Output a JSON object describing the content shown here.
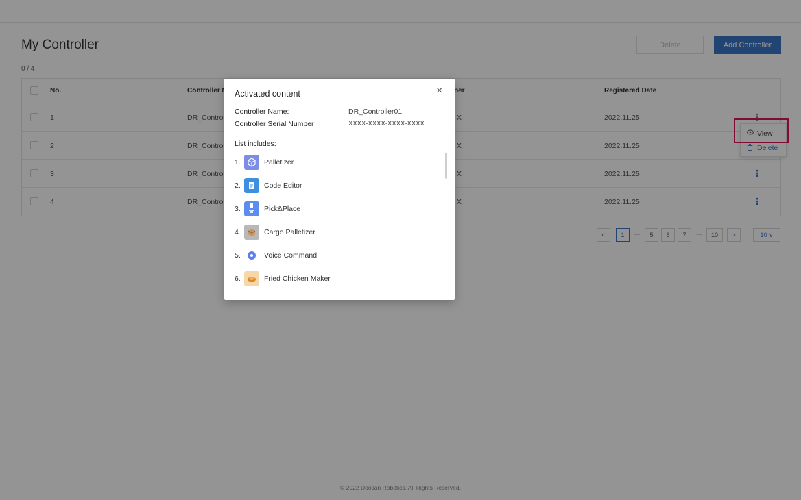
{
  "page": {
    "title": "My Controller",
    "selection_count": "0 / 4",
    "delete_label": "Delete",
    "add_label": "Add Controller"
  },
  "table": {
    "headers": {
      "no": "No.",
      "name": "Controller Na",
      "serial": "ber",
      "date": "Registered Date"
    },
    "rows": [
      {
        "no": "1",
        "name": "DR_Controll",
        "serial": "X",
        "date": "2022.11.25",
        "menu": "⋮"
      },
      {
        "no": "2",
        "name": "DR_Controll",
        "serial": "X",
        "date": "2022.11.25",
        "menu": "⋮"
      },
      {
        "no": "3",
        "name": "DR_Controll",
        "serial": "X",
        "date": "2022.11.25",
        "menu": "⋮"
      },
      {
        "no": "4",
        "name": "DR_Controll",
        "serial": "X",
        "date": "2022.11.25",
        "menu": "⋮"
      }
    ]
  },
  "row_menu": {
    "view_label": "View",
    "delete_label": "Delete",
    "view_icon": "eye-icon",
    "delete_icon": "trash-icon"
  },
  "pagination": {
    "prev": "<",
    "pages": [
      "1",
      "5",
      "6",
      "7",
      "10"
    ],
    "dots": "···",
    "next": ">",
    "per_page": "10 ∨"
  },
  "footer": "© 2022 Doosan Robotics. All Rights Reserved.",
  "modal": {
    "title": "Activated content",
    "close": "×",
    "name_label": "Controller Name:",
    "name_value": "DR_Controller01",
    "serial_label": "Controller Serial Number",
    "serial_value": "XXXX-XXXX-XXXX-XXXX",
    "list_title": "List includes:",
    "items": [
      {
        "num": "1.",
        "label": "Palletizer",
        "icon": "palletizer-icon",
        "color": "#7b8de6"
      },
      {
        "num": "2.",
        "label": "Code Editor",
        "icon": "code-editor-icon",
        "color": "#3d8fe0"
      },
      {
        "num": "3.",
        "label": "Pick&Place",
        "icon": "pick-place-icon",
        "color": "#5b8df0"
      },
      {
        "num": "4.",
        "label": "Cargo Palletizer",
        "icon": "cargo-palletizer-icon",
        "color": "#b8b8b8"
      },
      {
        "num": "5.",
        "label": "Voice Command",
        "icon": "voice-command-icon",
        "color": "#ffffff"
      },
      {
        "num": "6.",
        "label": "Fried Chicken Maker",
        "icon": "fried-chicken-icon",
        "color": "#f6d7a8"
      }
    ]
  },
  "colors": {
    "accent": "#3a76c4",
    "highlight": "#e0145a"
  }
}
